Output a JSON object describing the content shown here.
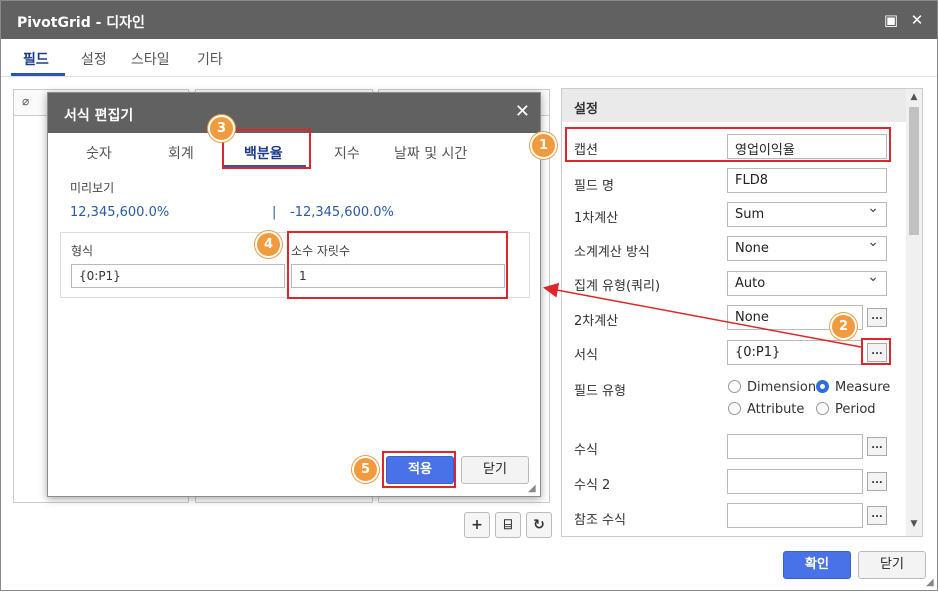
{
  "window": {
    "title": "PivotGrid - 디자인",
    "maximize_icon": "window-maximize-icon",
    "close_icon": "close-icon"
  },
  "main_tabs": [
    {
      "label": "필드",
      "active": true
    },
    {
      "label": "설정",
      "active": false
    },
    {
      "label": "스타일",
      "active": false
    },
    {
      "label": "기타",
      "active": false
    }
  ],
  "field_list": {
    "visibility_icon": "eye-slash-icon"
  },
  "toolbar": {
    "add_icon": "plus-icon",
    "delete_icon": "trash-icon",
    "refresh_icon": "refresh-icon"
  },
  "settings": {
    "header": "설정",
    "rows": {
      "caption": {
        "label": "캡션",
        "value": "영업이익율"
      },
      "field_name": {
        "label": "필드 명",
        "value": "FLD8"
      },
      "calc1": {
        "label": "1차계산",
        "value": "Sum"
      },
      "subtotal": {
        "label": "소계계산 방식",
        "value": "None"
      },
      "agg_type": {
        "label": "집계 유형(쿼리)",
        "value": "Auto"
      },
      "calc2": {
        "label": "2차계산",
        "value": "None"
      },
      "format": {
        "label": "서식",
        "value": "{0:P1}"
      },
      "field_type": {
        "label": "필드 유형",
        "options": [
          "Dimension",
          "Measure",
          "Attribute",
          "Period"
        ],
        "selected": "Measure"
      },
      "formula": {
        "label": "수식",
        "value": ""
      },
      "formula2": {
        "label": "수식 2",
        "value": ""
      },
      "ref_formula": {
        "label": "참조 수식",
        "value": ""
      }
    },
    "ellipsis": "..."
  },
  "footer": {
    "ok": "확인",
    "close": "닫기"
  },
  "dialog": {
    "title": "서식 편집기",
    "tabs": [
      {
        "label": "숫자",
        "active": false
      },
      {
        "label": "회계",
        "active": false
      },
      {
        "label": "백분율",
        "active": true
      },
      {
        "label": "지수",
        "active": false
      },
      {
        "label": "날짜 및 시간",
        "active": false
      }
    ],
    "preview_label": "미리보기",
    "preview_positive": "12,345,600.0%",
    "preview_separator": "|",
    "preview_negative": "-12,345,600.0%",
    "format_label": "형식",
    "format_value": "{0:P1}",
    "decimals_label": "소수 자릿수",
    "decimals_value": "1",
    "apply": "적용",
    "close": "닫기"
  },
  "badges": [
    "1",
    "2",
    "3",
    "4",
    "5"
  ],
  "colors": {
    "accent": "#2b55b5",
    "primary_button": "#4a72e8",
    "callout": "#e0262a",
    "badge": "#f19a3e",
    "titlebar": "#616161"
  }
}
